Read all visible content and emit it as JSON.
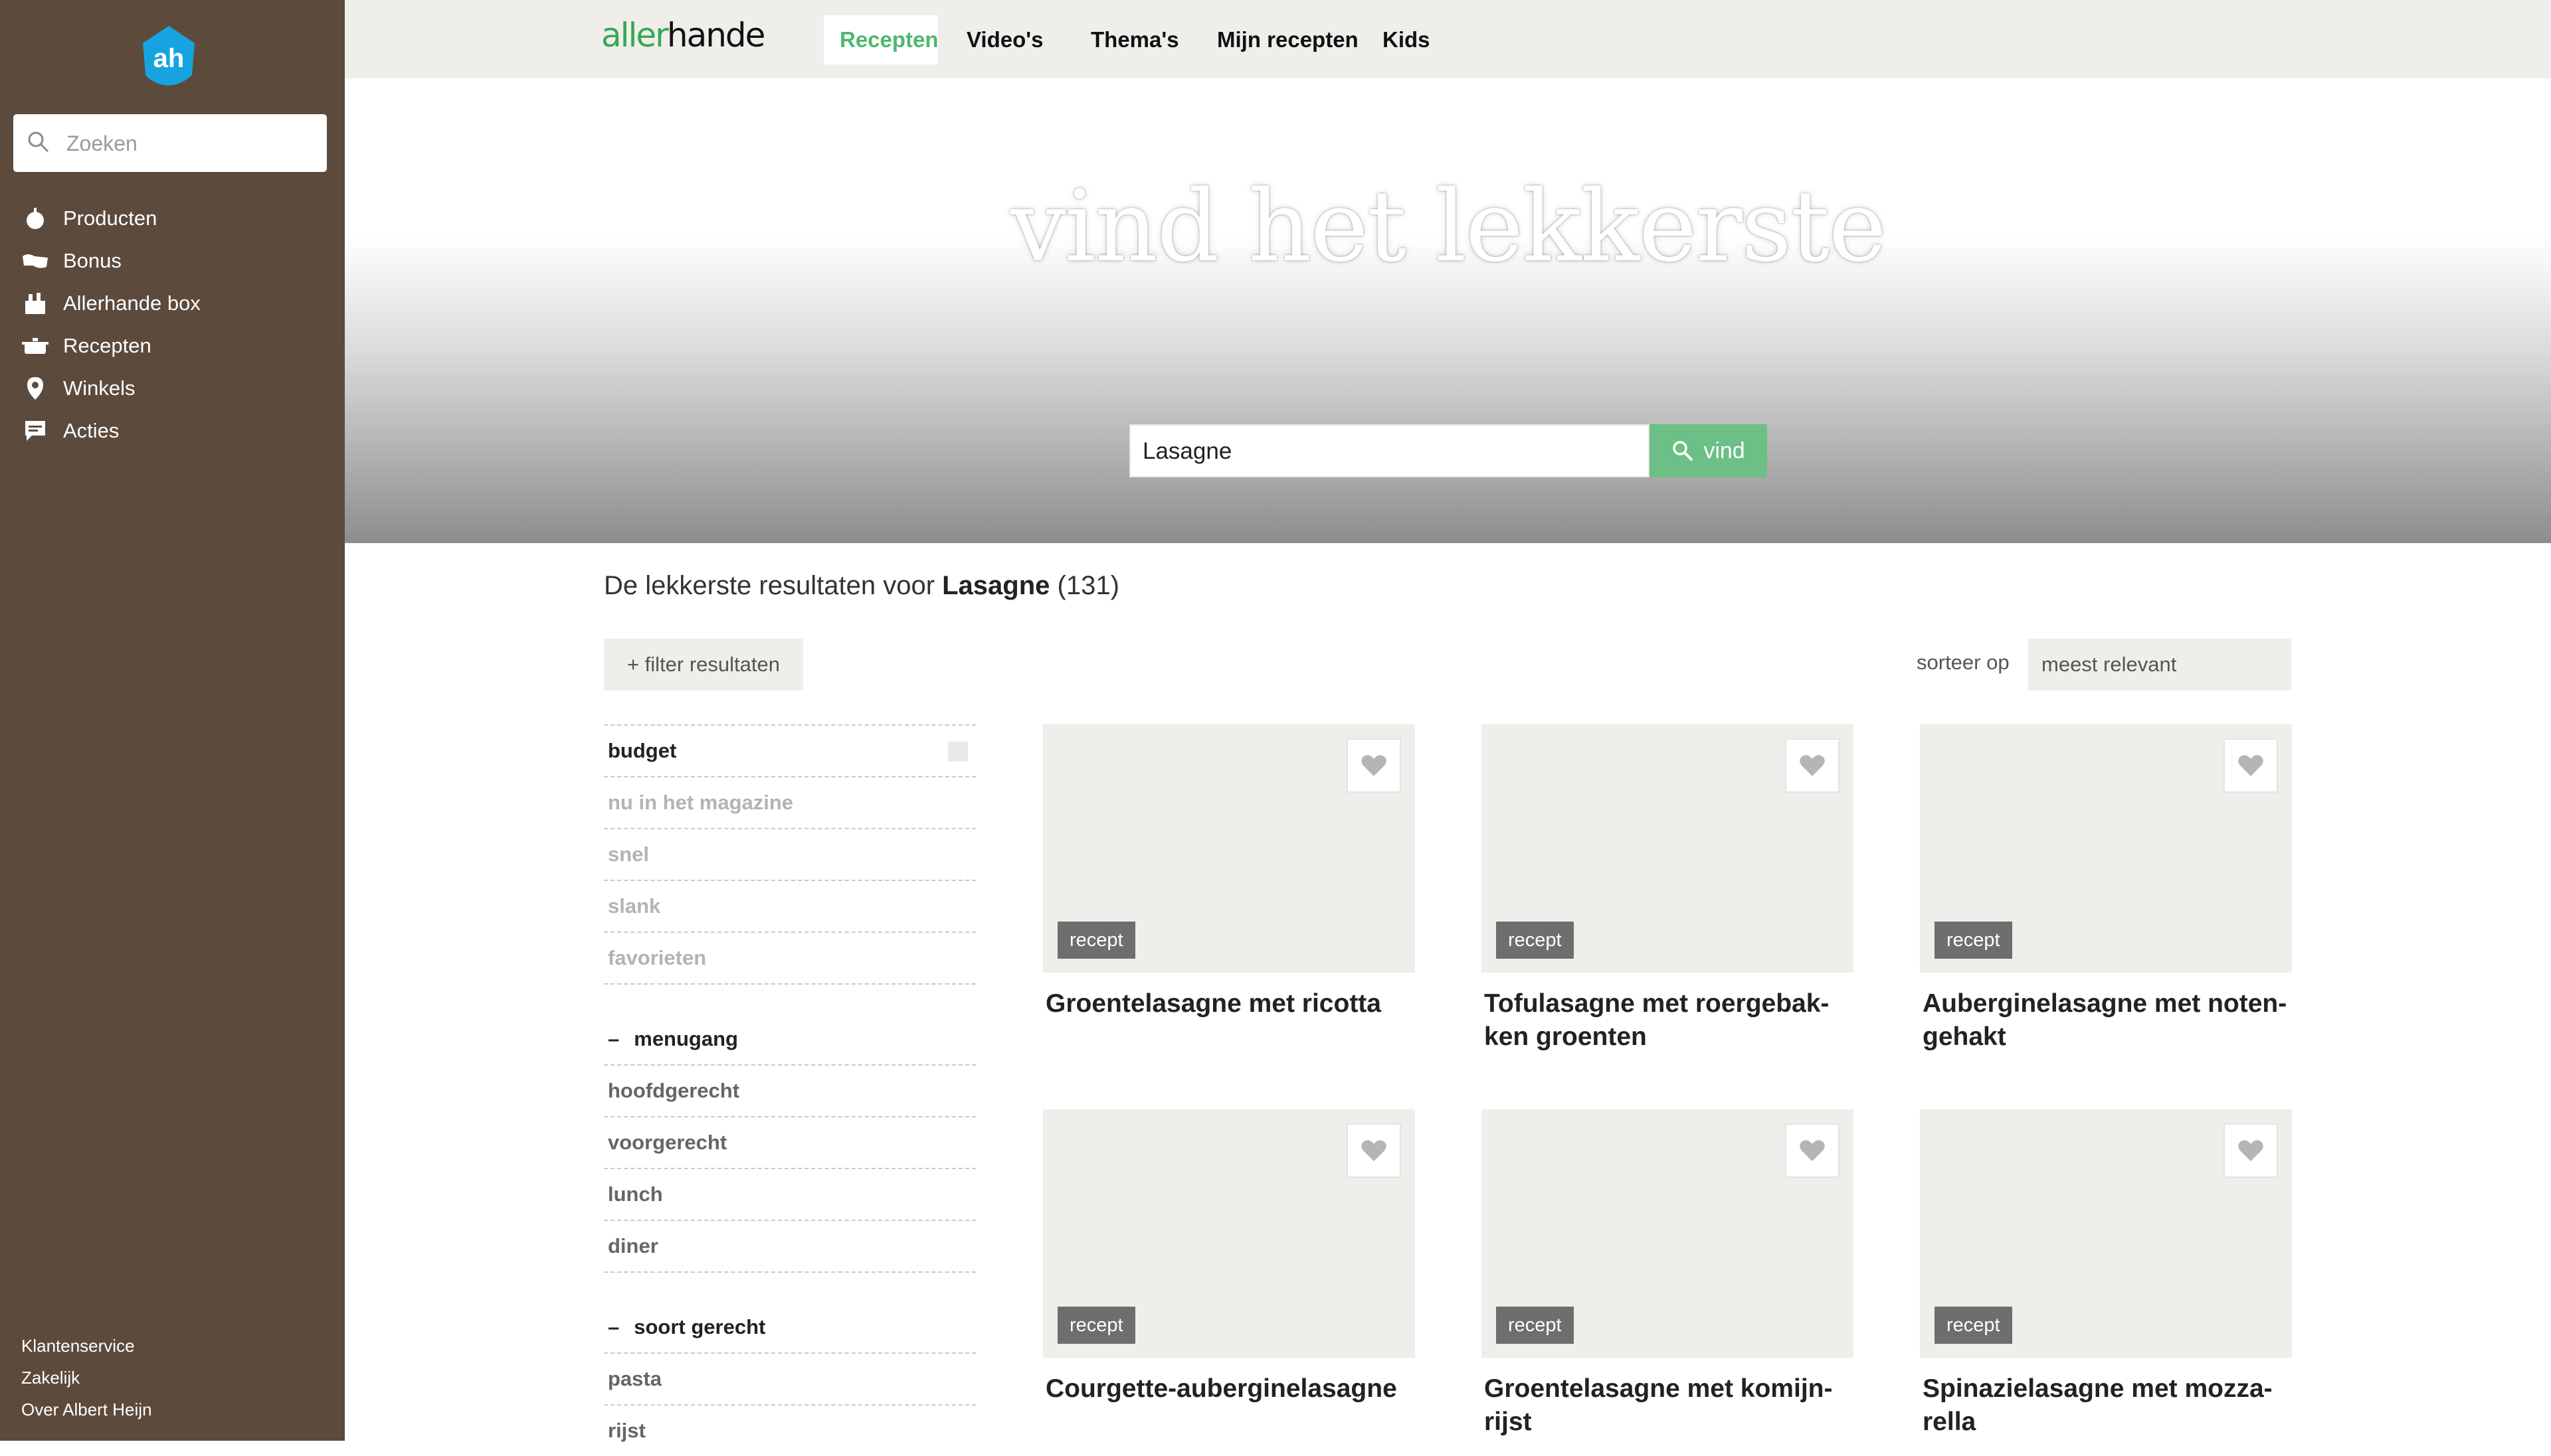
{
  "sidebar": {
    "search_placeholder": "Zoeken",
    "items": [
      {
        "label": "Producten",
        "icon": "apple-icon"
      },
      {
        "label": "Bonus",
        "icon": "bonus-icon"
      },
      {
        "label": "Allerhande box",
        "icon": "box-icon"
      },
      {
        "label": "Recepten",
        "icon": "pan-icon"
      },
      {
        "label": "Winkels",
        "icon": "location-pin-icon"
      },
      {
        "label": "Acties",
        "icon": "chat-icon"
      }
    ],
    "footer": [
      "Klantenservice",
      "Zakelijk",
      "Over Albert Heijn"
    ]
  },
  "header": {
    "brand_a": "aller",
    "brand_b": "hande",
    "tabs": [
      {
        "label": "Recepten",
        "active": true
      },
      {
        "label": "Video's"
      },
      {
        "label": "Thema's"
      },
      {
        "label": "Mijn recepten"
      },
      {
        "label": "Kids"
      }
    ]
  },
  "hero": {
    "title": "vind het lekkerste",
    "search_value": "Lasagne",
    "button_label": "vind"
  },
  "results": {
    "prefix": "De lekkerste resultaten voor ",
    "query": "Lasagne",
    "count": "(131)",
    "filter_button": "+   filter resultaten",
    "sort_label": "sorteer op",
    "sort_value": "meest relevant"
  },
  "filters": {
    "quick": [
      "budget",
      "nu in het magazine",
      "snel",
      "slank",
      "favorieten"
    ],
    "menugang": {
      "title": "menugang",
      "items": [
        "hoofdgerecht",
        "voorgerecht",
        "lunch",
        "diner"
      ]
    },
    "soort": {
      "title": "soort gerecht",
      "items": [
        "pasta",
        "rijst"
      ]
    }
  },
  "cards": [
    {
      "tag": "recept",
      "title": "Groentelasagne met ricotta"
    },
    {
      "tag": "recept",
      "title": "Tofulasagne met roergebak-ken groenten"
    },
    {
      "tag": "recept",
      "title": "Auberginelasagne met noten-gehakt"
    },
    {
      "tag": "recept",
      "title": "Courgette-auberginelasagne"
    },
    {
      "tag": "recept",
      "title": "Groentelasagne met komijn-rijst"
    },
    {
      "tag": "recept",
      "title": "Spinazielasagne met mozza-rella"
    }
  ],
  "colors": {
    "sidebar": "#5c4a3c",
    "accent_green": "#4db86e",
    "button_green": "#6cbf85",
    "logo_blue": "#17a3e0"
  }
}
